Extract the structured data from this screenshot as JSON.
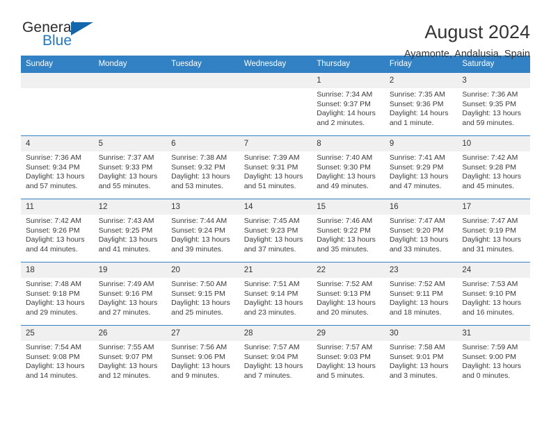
{
  "brand": {
    "name_part1": "General",
    "name_part2": "Blue",
    "accent_color": "#1267ad",
    "blue_text_color": "#1f78c1"
  },
  "header": {
    "title": "August 2024",
    "subtitle": "Ayamonte, Andalusia, Spain"
  },
  "calendar": {
    "header_bg": "#3281c4",
    "daynum_bg": "#f0f0f0",
    "weekday_headers": [
      "Sunday",
      "Monday",
      "Tuesday",
      "Wednesday",
      "Thursday",
      "Friday",
      "Saturday"
    ],
    "weeks": [
      [
        {
          "day": "",
          "empty": true
        },
        {
          "day": "",
          "empty": true
        },
        {
          "day": "",
          "empty": true
        },
        {
          "day": "",
          "empty": true
        },
        {
          "day": "1",
          "sunrise": "Sunrise: 7:34 AM",
          "sunset": "Sunset: 9:37 PM",
          "daylight_line1": "Daylight: 14 hours",
          "daylight_line2": "and 2 minutes."
        },
        {
          "day": "2",
          "sunrise": "Sunrise: 7:35 AM",
          "sunset": "Sunset: 9:36 PM",
          "daylight_line1": "Daylight: 14 hours",
          "daylight_line2": "and 1 minute."
        },
        {
          "day": "3",
          "sunrise": "Sunrise: 7:36 AM",
          "sunset": "Sunset: 9:35 PM",
          "daylight_line1": "Daylight: 13 hours",
          "daylight_line2": "and 59 minutes."
        }
      ],
      [
        {
          "day": "4",
          "sunrise": "Sunrise: 7:36 AM",
          "sunset": "Sunset: 9:34 PM",
          "daylight_line1": "Daylight: 13 hours",
          "daylight_line2": "and 57 minutes."
        },
        {
          "day": "5",
          "sunrise": "Sunrise: 7:37 AM",
          "sunset": "Sunset: 9:33 PM",
          "daylight_line1": "Daylight: 13 hours",
          "daylight_line2": "and 55 minutes."
        },
        {
          "day": "6",
          "sunrise": "Sunrise: 7:38 AM",
          "sunset": "Sunset: 9:32 PM",
          "daylight_line1": "Daylight: 13 hours",
          "daylight_line2": "and 53 minutes."
        },
        {
          "day": "7",
          "sunrise": "Sunrise: 7:39 AM",
          "sunset": "Sunset: 9:31 PM",
          "daylight_line1": "Daylight: 13 hours",
          "daylight_line2": "and 51 minutes."
        },
        {
          "day": "8",
          "sunrise": "Sunrise: 7:40 AM",
          "sunset": "Sunset: 9:30 PM",
          "daylight_line1": "Daylight: 13 hours",
          "daylight_line2": "and 49 minutes."
        },
        {
          "day": "9",
          "sunrise": "Sunrise: 7:41 AM",
          "sunset": "Sunset: 9:29 PM",
          "daylight_line1": "Daylight: 13 hours",
          "daylight_line2": "and 47 minutes."
        },
        {
          "day": "10",
          "sunrise": "Sunrise: 7:42 AM",
          "sunset": "Sunset: 9:28 PM",
          "daylight_line1": "Daylight: 13 hours",
          "daylight_line2": "and 45 minutes."
        }
      ],
      [
        {
          "day": "11",
          "sunrise": "Sunrise: 7:42 AM",
          "sunset": "Sunset: 9:26 PM",
          "daylight_line1": "Daylight: 13 hours",
          "daylight_line2": "and 44 minutes."
        },
        {
          "day": "12",
          "sunrise": "Sunrise: 7:43 AM",
          "sunset": "Sunset: 9:25 PM",
          "daylight_line1": "Daylight: 13 hours",
          "daylight_line2": "and 41 minutes."
        },
        {
          "day": "13",
          "sunrise": "Sunrise: 7:44 AM",
          "sunset": "Sunset: 9:24 PM",
          "daylight_line1": "Daylight: 13 hours",
          "daylight_line2": "and 39 minutes."
        },
        {
          "day": "14",
          "sunrise": "Sunrise: 7:45 AM",
          "sunset": "Sunset: 9:23 PM",
          "daylight_line1": "Daylight: 13 hours",
          "daylight_line2": "and 37 minutes."
        },
        {
          "day": "15",
          "sunrise": "Sunrise: 7:46 AM",
          "sunset": "Sunset: 9:22 PM",
          "daylight_line1": "Daylight: 13 hours",
          "daylight_line2": "and 35 minutes."
        },
        {
          "day": "16",
          "sunrise": "Sunrise: 7:47 AM",
          "sunset": "Sunset: 9:20 PM",
          "daylight_line1": "Daylight: 13 hours",
          "daylight_line2": "and 33 minutes."
        },
        {
          "day": "17",
          "sunrise": "Sunrise: 7:47 AM",
          "sunset": "Sunset: 9:19 PM",
          "daylight_line1": "Daylight: 13 hours",
          "daylight_line2": "and 31 minutes."
        }
      ],
      [
        {
          "day": "18",
          "sunrise": "Sunrise: 7:48 AM",
          "sunset": "Sunset: 9:18 PM",
          "daylight_line1": "Daylight: 13 hours",
          "daylight_line2": "and 29 minutes."
        },
        {
          "day": "19",
          "sunrise": "Sunrise: 7:49 AM",
          "sunset": "Sunset: 9:16 PM",
          "daylight_line1": "Daylight: 13 hours",
          "daylight_line2": "and 27 minutes."
        },
        {
          "day": "20",
          "sunrise": "Sunrise: 7:50 AM",
          "sunset": "Sunset: 9:15 PM",
          "daylight_line1": "Daylight: 13 hours",
          "daylight_line2": "and 25 minutes."
        },
        {
          "day": "21",
          "sunrise": "Sunrise: 7:51 AM",
          "sunset": "Sunset: 9:14 PM",
          "daylight_line1": "Daylight: 13 hours",
          "daylight_line2": "and 23 minutes."
        },
        {
          "day": "22",
          "sunrise": "Sunrise: 7:52 AM",
          "sunset": "Sunset: 9:13 PM",
          "daylight_line1": "Daylight: 13 hours",
          "daylight_line2": "and 20 minutes."
        },
        {
          "day": "23",
          "sunrise": "Sunrise: 7:52 AM",
          "sunset": "Sunset: 9:11 PM",
          "daylight_line1": "Daylight: 13 hours",
          "daylight_line2": "and 18 minutes."
        },
        {
          "day": "24",
          "sunrise": "Sunrise: 7:53 AM",
          "sunset": "Sunset: 9:10 PM",
          "daylight_line1": "Daylight: 13 hours",
          "daylight_line2": "and 16 minutes."
        }
      ],
      [
        {
          "day": "25",
          "sunrise": "Sunrise: 7:54 AM",
          "sunset": "Sunset: 9:08 PM",
          "daylight_line1": "Daylight: 13 hours",
          "daylight_line2": "and 14 minutes."
        },
        {
          "day": "26",
          "sunrise": "Sunrise: 7:55 AM",
          "sunset": "Sunset: 9:07 PM",
          "daylight_line1": "Daylight: 13 hours",
          "daylight_line2": "and 12 minutes."
        },
        {
          "day": "27",
          "sunrise": "Sunrise: 7:56 AM",
          "sunset": "Sunset: 9:06 PM",
          "daylight_line1": "Daylight: 13 hours",
          "daylight_line2": "and 9 minutes."
        },
        {
          "day": "28",
          "sunrise": "Sunrise: 7:57 AM",
          "sunset": "Sunset: 9:04 PM",
          "daylight_line1": "Daylight: 13 hours",
          "daylight_line2": "and 7 minutes."
        },
        {
          "day": "29",
          "sunrise": "Sunrise: 7:57 AM",
          "sunset": "Sunset: 9:03 PM",
          "daylight_line1": "Daylight: 13 hours",
          "daylight_line2": "and 5 minutes."
        },
        {
          "day": "30",
          "sunrise": "Sunrise: 7:58 AM",
          "sunset": "Sunset: 9:01 PM",
          "daylight_line1": "Daylight: 13 hours",
          "daylight_line2": "and 3 minutes."
        },
        {
          "day": "31",
          "sunrise": "Sunrise: 7:59 AM",
          "sunset": "Sunset: 9:00 PM",
          "daylight_line1": "Daylight: 13 hours",
          "daylight_line2": "and 0 minutes."
        }
      ]
    ]
  }
}
